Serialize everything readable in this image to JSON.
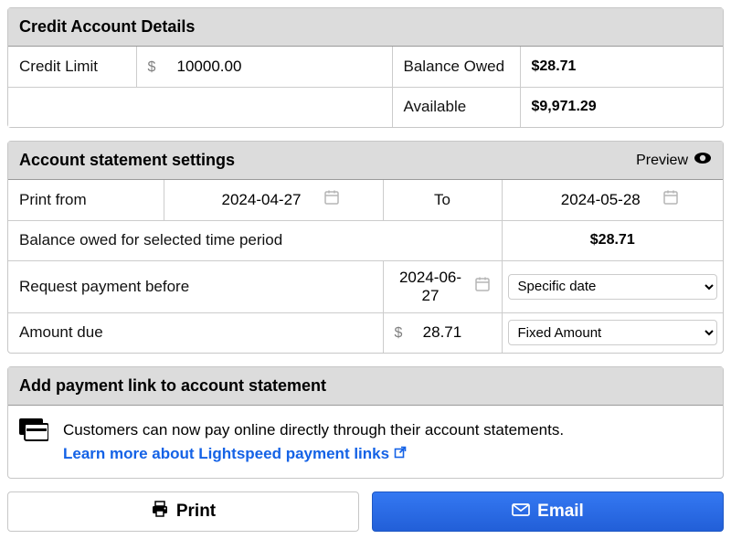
{
  "credit_panel": {
    "title": "Credit Account Details",
    "labels": {
      "credit_limit": "Credit Limit",
      "currency": "$",
      "balance_owed": "Balance Owed",
      "available": "Available"
    },
    "values": {
      "credit_limit_value": "10000.00",
      "balance_owed": "$28.71",
      "available": "$9,971.29"
    }
  },
  "statement_panel": {
    "title": "Account statement settings",
    "preview_label": "Preview",
    "labels": {
      "print_from": "Print from",
      "to": "To",
      "balance_owed_period": "Balance owed for selected time period",
      "request_before": "Request payment before",
      "amount_due": "Amount due",
      "currency": "$"
    },
    "values": {
      "from_date": "2024-04-27",
      "to_date": "2024-05-28",
      "balance_owed_period": "$28.71",
      "request_before_date": "2024-06-27",
      "due_type": "Specific date",
      "amount_due_value": "28.71",
      "amount_type": "Fixed Amount"
    },
    "due_type_options": [
      "Specific date"
    ],
    "amount_type_options": [
      "Fixed Amount"
    ]
  },
  "paylink_panel": {
    "title": "Add payment link to account statement",
    "message": "Customers can now pay online directly through their account statements.",
    "link_text": "Learn more about Lightspeed payment links"
  },
  "buttons": {
    "print": "Print",
    "email": "Email"
  }
}
